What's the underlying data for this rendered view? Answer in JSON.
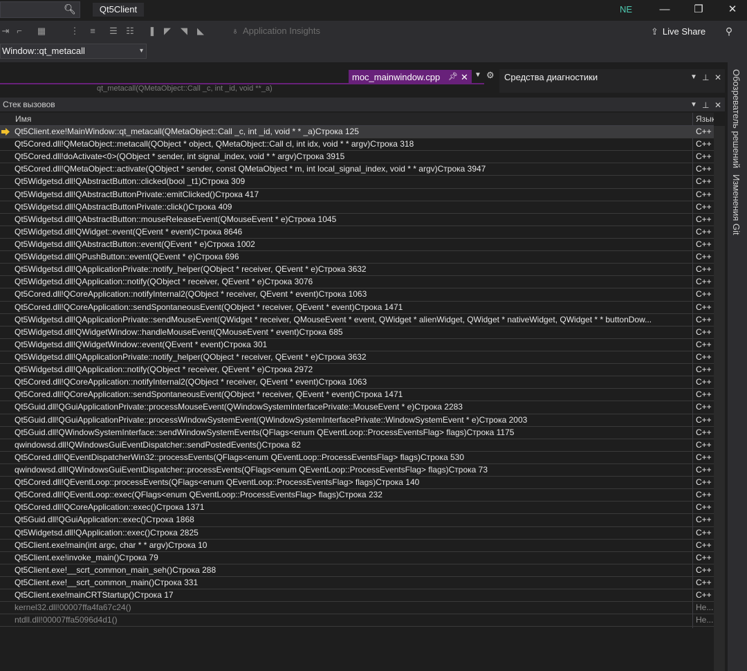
{
  "titlebar": {
    "app_title": "Qt5Client",
    "user_initials": "NE",
    "minimize": "—",
    "maximize": "❐",
    "close": "✕"
  },
  "toolbar": {
    "insights_label": "Application Insights",
    "liveshare_label": "Live Share"
  },
  "member_combo": {
    "value": "Window::qt_metacall"
  },
  "editor": {
    "tab_file": "moc_mainwindow.cpp",
    "peek_text": "qt_metacall(QMetaObject::Call _c, int _id, void **_a)"
  },
  "diagnostics": {
    "title": "Средства диагностики"
  },
  "right_rail": {
    "tab1": "Обозреватель решений",
    "tab2": "Изменения Git"
  },
  "call_stack": {
    "title": "Стек вызовов",
    "columns": {
      "name": "Имя",
      "lang": "Язык"
    },
    "rows": [
      {
        "name": "Qt5Client.exe!MainWindow::qt_metacall(QMetaObject::Call _c, int _id, void * * _a)Строка 125",
        "lang": "C++",
        "current": true
      },
      {
        "name": "Qt5Cored.dll!QMetaObject::metacall(QObject * object, QMetaObject::Call cl, int idx, void * * argv)Строка 318",
        "lang": "C++"
      },
      {
        "name": "Qt5Cored.dll!doActivate<0>(QObject * sender, int signal_index, void * * argv)Строка 3915",
        "lang": "C++"
      },
      {
        "name": "Qt5Cored.dll!QMetaObject::activate(QObject * sender, const QMetaObject * m, int local_signal_index, void * * argv)Строка 3947",
        "lang": "C++"
      },
      {
        "name": "Qt5Widgetsd.dll!QAbstractButton::clicked(bool _t1)Строка 309",
        "lang": "C++"
      },
      {
        "name": "Qt5Widgetsd.dll!QAbstractButtonPrivate::emitClicked()Строка 417",
        "lang": "C++"
      },
      {
        "name": "Qt5Widgetsd.dll!QAbstractButtonPrivate::click()Строка 409",
        "lang": "C++"
      },
      {
        "name": "Qt5Widgetsd.dll!QAbstractButton::mouseReleaseEvent(QMouseEvent * e)Строка 1045",
        "lang": "C++"
      },
      {
        "name": "Qt5Widgetsd.dll!QWidget::event(QEvent * event)Строка 8646",
        "lang": "C++"
      },
      {
        "name": "Qt5Widgetsd.dll!QAbstractButton::event(QEvent * e)Строка 1002",
        "lang": "C++"
      },
      {
        "name": "Qt5Widgetsd.dll!QPushButton::event(QEvent * e)Строка 696",
        "lang": "C++"
      },
      {
        "name": "Qt5Widgetsd.dll!QApplicationPrivate::notify_helper(QObject * receiver, QEvent * e)Строка 3632",
        "lang": "C++"
      },
      {
        "name": "Qt5Widgetsd.dll!QApplication::notify(QObject * receiver, QEvent * e)Строка 3076",
        "lang": "C++"
      },
      {
        "name": "Qt5Cored.dll!QCoreApplication::notifyInternal2(QObject * receiver, QEvent * event)Строка 1063",
        "lang": "C++"
      },
      {
        "name": "Qt5Cored.dll!QCoreApplication::sendSpontaneousEvent(QObject * receiver, QEvent * event)Строка 1471",
        "lang": "C++"
      },
      {
        "name": "Qt5Widgetsd.dll!QApplicationPrivate::sendMouseEvent(QWidget * receiver, QMouseEvent * event, QWidget * alienWidget, QWidget * nativeWidget, QWidget * * buttonDow...",
        "lang": "C++"
      },
      {
        "name": "Qt5Widgetsd.dll!QWidgetWindow::handleMouseEvent(QMouseEvent * event)Строка 685",
        "lang": "C++"
      },
      {
        "name": "Qt5Widgetsd.dll!QWidgetWindow::event(QEvent * event)Строка 301",
        "lang": "C++"
      },
      {
        "name": "Qt5Widgetsd.dll!QApplicationPrivate::notify_helper(QObject * receiver, QEvent * e)Строка 3632",
        "lang": "C++"
      },
      {
        "name": "Qt5Widgetsd.dll!QApplication::notify(QObject * receiver, QEvent * e)Строка 2972",
        "lang": "C++"
      },
      {
        "name": "Qt5Cored.dll!QCoreApplication::notifyInternal2(QObject * receiver, QEvent * event)Строка 1063",
        "lang": "C++"
      },
      {
        "name": "Qt5Cored.dll!QCoreApplication::sendSpontaneousEvent(QObject * receiver, QEvent * event)Строка 1471",
        "lang": "C++"
      },
      {
        "name": "Qt5Guid.dll!QGuiApplicationPrivate::processMouseEvent(QWindowSystemInterfacePrivate::MouseEvent * e)Строка 2283",
        "lang": "C++"
      },
      {
        "name": "Qt5Guid.dll!QGuiApplicationPrivate::processWindowSystemEvent(QWindowSystemInterfacePrivate::WindowSystemEvent * e)Строка 2003",
        "lang": "C++"
      },
      {
        "name": "Qt5Guid.dll!QWindowSystemInterface::sendWindowSystemEvents(QFlags<enum QEventLoop::ProcessEventsFlag> flags)Строка 1175",
        "lang": "C++"
      },
      {
        "name": "qwindowsd.dll!QWindowsGuiEventDispatcher::sendPostedEvents()Строка 82",
        "lang": "C++"
      },
      {
        "name": "Qt5Cored.dll!QEventDispatcherWin32::processEvents(QFlags<enum QEventLoop::ProcessEventsFlag> flags)Строка 530",
        "lang": "C++"
      },
      {
        "name": "qwindowsd.dll!QWindowsGuiEventDispatcher::processEvents(QFlags<enum QEventLoop::ProcessEventsFlag> flags)Строка 73",
        "lang": "C++"
      },
      {
        "name": "Qt5Cored.dll!QEventLoop::processEvents(QFlags<enum QEventLoop::ProcessEventsFlag> flags)Строка 140",
        "lang": "C++"
      },
      {
        "name": "Qt5Cored.dll!QEventLoop::exec(QFlags<enum QEventLoop::ProcessEventsFlag> flags)Строка 232",
        "lang": "C++"
      },
      {
        "name": "Qt5Cored.dll!QCoreApplication::exec()Строка 1371",
        "lang": "C++"
      },
      {
        "name": "Qt5Guid.dll!QGuiApplication::exec()Строка 1868",
        "lang": "C++"
      },
      {
        "name": "Qt5Widgetsd.dll!QApplication::exec()Строка 2825",
        "lang": "C++"
      },
      {
        "name": "Qt5Client.exe!main(int argc, char * * argv)Строка 10",
        "lang": "C++"
      },
      {
        "name": "Qt5Client.exe!invoke_main()Строка 79",
        "lang": "C++"
      },
      {
        "name": "Qt5Client.exe!__scrt_common_main_seh()Строка 288",
        "lang": "C++"
      },
      {
        "name": "Qt5Client.exe!__scrt_common_main()Строка 331",
        "lang": "C++"
      },
      {
        "name": "Qt5Client.exe!mainCRTStartup()Строка 17",
        "lang": "C++"
      },
      {
        "name": "kernel32.dll!00007ffa4fa67c24()",
        "lang": "Не...",
        "external": true
      },
      {
        "name": "ntdll.dll!00007ffa5096d4d1()",
        "lang": "Не...",
        "external": true
      }
    ]
  },
  "colors": {
    "accent_tab": "#68217a",
    "current_arrow": "#f2c12e",
    "background": "#1e1e1e"
  }
}
